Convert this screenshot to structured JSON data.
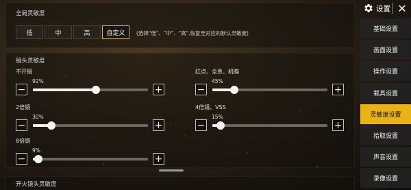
{
  "global": {
    "title": "全局灵敏度",
    "options": [
      "低",
      "中",
      "高",
      "自定义"
    ],
    "selected": "自定义",
    "hint": "(选择\"低\"、\"中\"、\"高\",恢复至对应的默认灵敏度)"
  },
  "scope": {
    "title": "镜头灵敏度",
    "sliders": [
      {
        "label": "不开镜",
        "value_text": "92%",
        "value": 0.55
      },
      {
        "label": "红点、全息、机瞄",
        "value_text": "45%",
        "value": 0.19
      },
      {
        "label": "2倍镜",
        "value_text": "30%",
        "value": 0.16
      },
      {
        "label": "4倍镜、VSS",
        "value_text": "15%",
        "value": 0.07
      },
      {
        "label": "8倍镜",
        "value_text": "9%",
        "value": 0.05
      }
    ],
    "minus_symbol": "−",
    "plus_symbol": "+"
  },
  "fire": {
    "title": "开火镜头灵敏度"
  },
  "menu": {
    "title": "设置",
    "close": "✕",
    "items": [
      "基础设置",
      "画面设置",
      "操作设置",
      "载具设置",
      "灵敏度设置",
      "拾取设置",
      "声音设置",
      "录像设置"
    ],
    "active": "灵敏度设置"
  },
  "colors": {
    "accent": "#e9b413",
    "selected_border": "#d9b04a"
  }
}
